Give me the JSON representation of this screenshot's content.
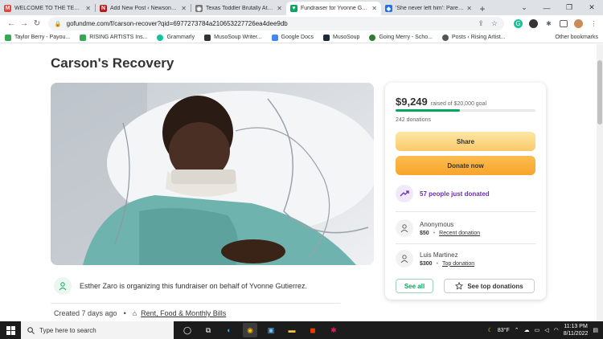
{
  "browser": {
    "tabs": [
      {
        "title": "WELCOME TO THE TEAM - ta",
        "favicon_letter": "M",
        "favicon_color": "#ea4335",
        "active": false
      },
      {
        "title": "Add New Post ‹ Newsonyx —",
        "favicon_letter": "N",
        "favicon_color": "#b71c1c",
        "active": false
      },
      {
        "title": "Texas Toddler Brutally Attack",
        "favicon_letter": "",
        "favicon_color": "#777777",
        "active": false
      },
      {
        "title": "Fundraiser for Yvonne Gutiér",
        "favicon_letter": "",
        "favicon_color": "#02a95c",
        "active": true
      },
      {
        "title": "'She never left him': Parents",
        "favicon_letter": "",
        "favicon_color": "#1a73e8",
        "active": false
      }
    ],
    "url": "gofundme.com/f/carson-recover?qid=6977273784a210653227726ea4dee9db",
    "bookmarks": [
      {
        "label": "Taylor Berry - Payou...",
        "color": "#34a853"
      },
      {
        "label": "RISING ARTISTS Ins...",
        "color": "#34a853"
      },
      {
        "label": "Grammarly",
        "color": "#15c39a"
      },
      {
        "label": "MusoSoup Writer...",
        "color": "#333333"
      },
      {
        "label": "Google Docs",
        "color": "#4285f4"
      },
      {
        "label": "MusoSoup",
        "color": "#1e2a3a"
      },
      {
        "label": "Going Merry - Scho...",
        "color": "#2e7d32"
      },
      {
        "label": "Posts ‹ Rising Artist...",
        "color": "#555555"
      }
    ],
    "other_bookmarks": "Other bookmarks"
  },
  "page": {
    "title": "Carson's Recovery",
    "organizer_text": "Esther Zaro is organizing this fundraiser on behalf of Yvonne Gutierrez.",
    "created": "Created 7 days ago",
    "category": "Rent, Food & Monthly Bills"
  },
  "card": {
    "raised": "$9,249",
    "goal_text": "raised of $20,000 goal",
    "progress_pct": 46,
    "donations": "242 donations",
    "share_label": "Share",
    "donate_label": "Donate now",
    "trend_text": "57 people just donated",
    "donors": [
      {
        "name": "Anonymous",
        "amount": "$50",
        "tag": "Recent donation"
      },
      {
        "name": "Luis Martinez",
        "amount": "$300",
        "tag": "Top donation"
      }
    ],
    "see_all_label": "See all",
    "see_top_label": "See top donations"
  },
  "taskbar": {
    "search_placeholder": "Type here to search",
    "weather": "83°F",
    "time": "11:13 PM",
    "date": "8/11/2022"
  },
  "colors": {
    "brand_green": "#02a95c",
    "trend_purple": "#6b2fb3",
    "donate_orange": "#f8a52d"
  }
}
